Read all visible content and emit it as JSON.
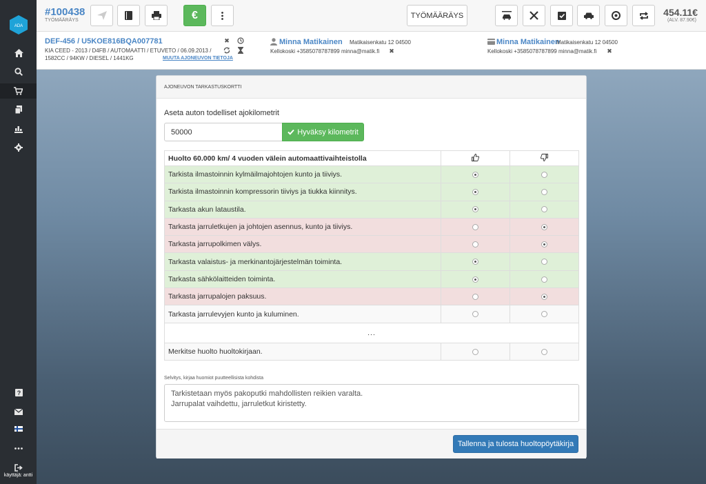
{
  "header": {
    "order_number": "#100438",
    "order_type": "TYÖMÄÄRÄYS",
    "order_button_label": "TYÖMÄÄRÄYS",
    "price": "454.11€",
    "price_vat": "(ALV. 87.90€)"
  },
  "vehicle": {
    "title": "DEF-456 / U5KOE816BQA007781",
    "line1": "KIA CEED - 2013 / D4FB / AUTOMAATTI / ETUVETO / 06.09.2013 /",
    "line2": "1582CC / 94KW / DIESEL / 1441KG",
    "edit_link": "MUUTA AJONEUVON TIETOJA"
  },
  "customer": {
    "name": "Minna Matikainen",
    "address": "Matikaisenkatu 12 04500",
    "contact": "Kellokoski +3585078787899 minna@matik.fi"
  },
  "payer": {
    "name": "Minna Matikainen",
    "address": "Matikaisenkatu 12 04500",
    "contact": "Kellokoski +3585078787899 minna@matik.fi"
  },
  "sidebar": {
    "logo_text": "ADA",
    "user_label": "käyttäjä: antti"
  },
  "panel": {
    "title": "AJONEUVON TARKASTUSKORTTI",
    "km_label": "Aseta auton todelliset ajokilometrit",
    "km_value": "50000",
    "km_button": "Hyväksy kilometrit",
    "table_title": "Huolto 60.000 km/ 4 vuoden välein automaattivaihteistolla",
    "rows": [
      {
        "label": "Tarkista ilmastoinnin kylmäilmajohtojen kunto ja tiiviys.",
        "status": "ok"
      },
      {
        "label": "Tarkista ilmastoinnin kompressorin tiiviys ja tiukka kiinnitys.",
        "status": "ok"
      },
      {
        "label": "Tarkasta akun lataustila.",
        "status": "ok"
      },
      {
        "label": "Tarkasta jarruletkujen ja johtojen asennus, kunto ja tiiviys.",
        "status": "bad"
      },
      {
        "label": "Tarkasta jarrupolkimen välys.",
        "status": "bad"
      },
      {
        "label": "Tarkasta valaistus- ja merkinantojärjestelmän toiminta.",
        "status": "ok"
      },
      {
        "label": "Tarkasta sähkölaitteiden toiminta.",
        "status": "ok"
      },
      {
        "label": "Tarkasta jarrupalojen paksuus.",
        "status": "bad"
      },
      {
        "label": "Tarkasta jarrulevyjen kunto ja kuluminen.",
        "status": "none"
      }
    ],
    "ellipsis": "...",
    "last_row": "Merkitse huolto huoltokirjaan.",
    "notes_label": "Selvitys, kirjaa huomiot puutteellisista kohdista",
    "notes_line1": "Tarkistetaan myös pakoputki mahdollisten reikien varalta.",
    "notes_line2": "Jarrupalat vaihdettu, jarruletkut kiristetty.",
    "save_button": "Tallenna ja tulosta huoltopöytäkirja"
  }
}
